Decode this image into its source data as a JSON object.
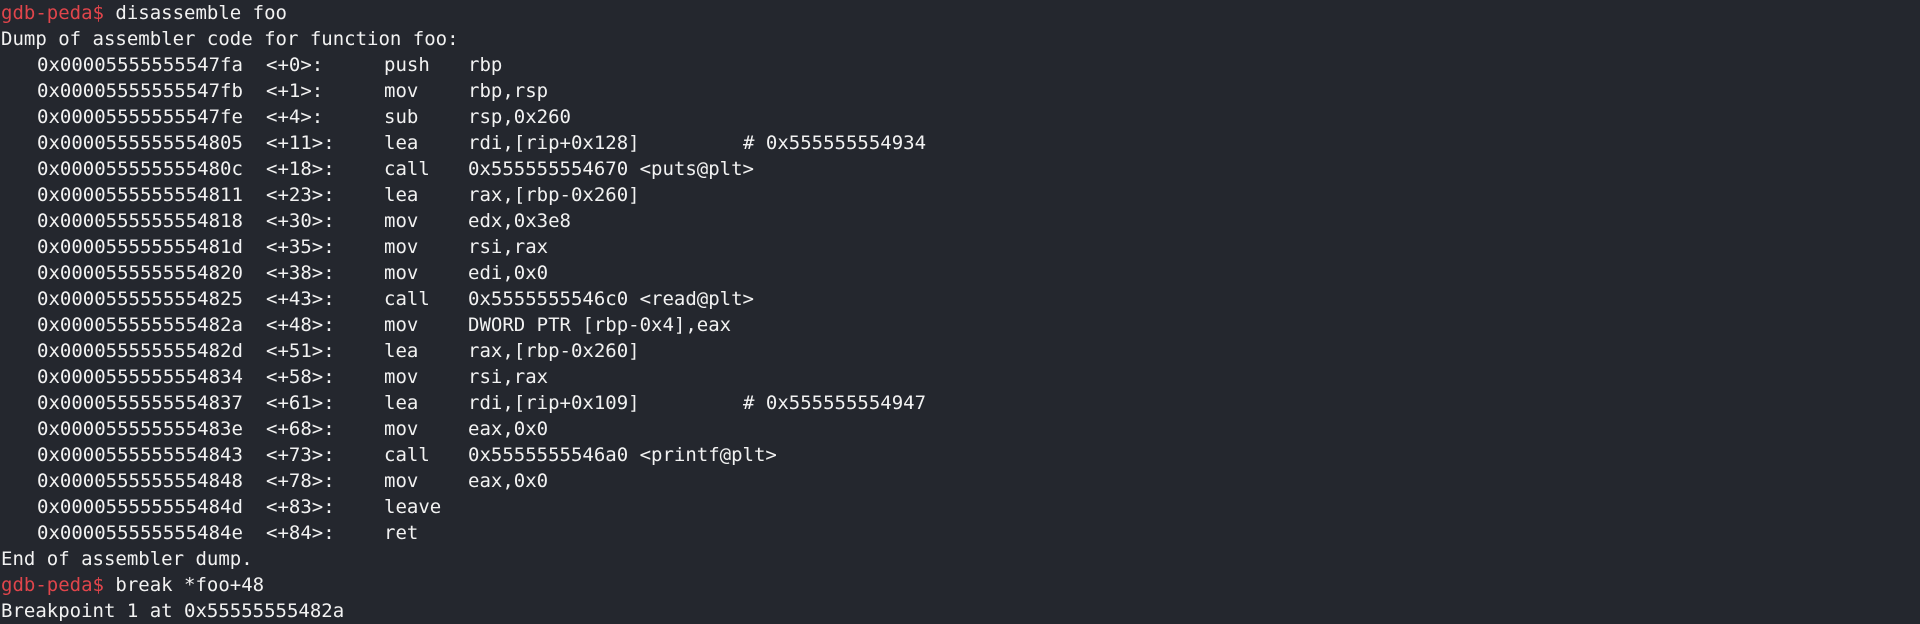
{
  "terminal": {
    "prompt": "gdb-peda$",
    "first_command": "disassemble foo",
    "dump_header": "Dump of assembler code for function foo:",
    "instructions": [
      {
        "addr": "0x00005555555547fa",
        "off": "<+0>:",
        "mnem": "push",
        "ops": "rbp",
        "comment": ""
      },
      {
        "addr": "0x00005555555547fb",
        "off": "<+1>:",
        "mnem": "mov",
        "ops": "rbp,rsp",
        "comment": ""
      },
      {
        "addr": "0x00005555555547fe",
        "off": "<+4>:",
        "mnem": "sub",
        "ops": "rsp,0x260",
        "comment": ""
      },
      {
        "addr": "0x0000555555554805",
        "off": "<+11>:",
        "mnem": "lea",
        "ops": "rdi,[rip+0x128]",
        "comment": "# 0x555555554934"
      },
      {
        "addr": "0x000055555555480c",
        "off": "<+18>:",
        "mnem": "call",
        "ops": "0x555555554670 <puts@plt>",
        "comment": ""
      },
      {
        "addr": "0x0000555555554811",
        "off": "<+23>:",
        "mnem": "lea",
        "ops": "rax,[rbp-0x260]",
        "comment": ""
      },
      {
        "addr": "0x0000555555554818",
        "off": "<+30>:",
        "mnem": "mov",
        "ops": "edx,0x3e8",
        "comment": ""
      },
      {
        "addr": "0x000055555555481d",
        "off": "<+35>:",
        "mnem": "mov",
        "ops": "rsi,rax",
        "comment": ""
      },
      {
        "addr": "0x0000555555554820",
        "off": "<+38>:",
        "mnem": "mov",
        "ops": "edi,0x0",
        "comment": ""
      },
      {
        "addr": "0x0000555555554825",
        "off": "<+43>:",
        "mnem": "call",
        "ops": "0x5555555546c0 <read@plt>",
        "comment": ""
      },
      {
        "addr": "0x000055555555482a",
        "off": "<+48>:",
        "mnem": "mov",
        "ops": "DWORD PTR [rbp-0x4],eax",
        "comment": ""
      },
      {
        "addr": "0x000055555555482d",
        "off": "<+51>:",
        "mnem": "lea",
        "ops": "rax,[rbp-0x260]",
        "comment": ""
      },
      {
        "addr": "0x0000555555554834",
        "off": "<+58>:",
        "mnem": "mov",
        "ops": "rsi,rax",
        "comment": ""
      },
      {
        "addr": "0x0000555555554837",
        "off": "<+61>:",
        "mnem": "lea",
        "ops": "rdi,[rip+0x109]",
        "comment": "# 0x555555554947"
      },
      {
        "addr": "0x000055555555483e",
        "off": "<+68>:",
        "mnem": "mov",
        "ops": "eax,0x0",
        "comment": ""
      },
      {
        "addr": "0x0000555555554843",
        "off": "<+73>:",
        "mnem": "call",
        "ops": "0x5555555546a0 <printf@plt>",
        "comment": ""
      },
      {
        "addr": "0x0000555555554848",
        "off": "<+78>:",
        "mnem": "mov",
        "ops": "eax,0x0",
        "comment": ""
      },
      {
        "addr": "0x000055555555484d",
        "off": "<+83>:",
        "mnem": "leave",
        "ops": "",
        "comment": ""
      },
      {
        "addr": "0x000055555555484e",
        "off": "<+84>:",
        "mnem": "ret",
        "ops": "",
        "comment": ""
      }
    ],
    "dump_footer": "End of assembler dump.",
    "second_command": "break *foo+48",
    "breakpoint_output": "Breakpoint 1 at 0x55555555482a"
  },
  "colors": {
    "background": "#24272e",
    "prompt": "#e0454b",
    "text": "#f2f2f2"
  }
}
